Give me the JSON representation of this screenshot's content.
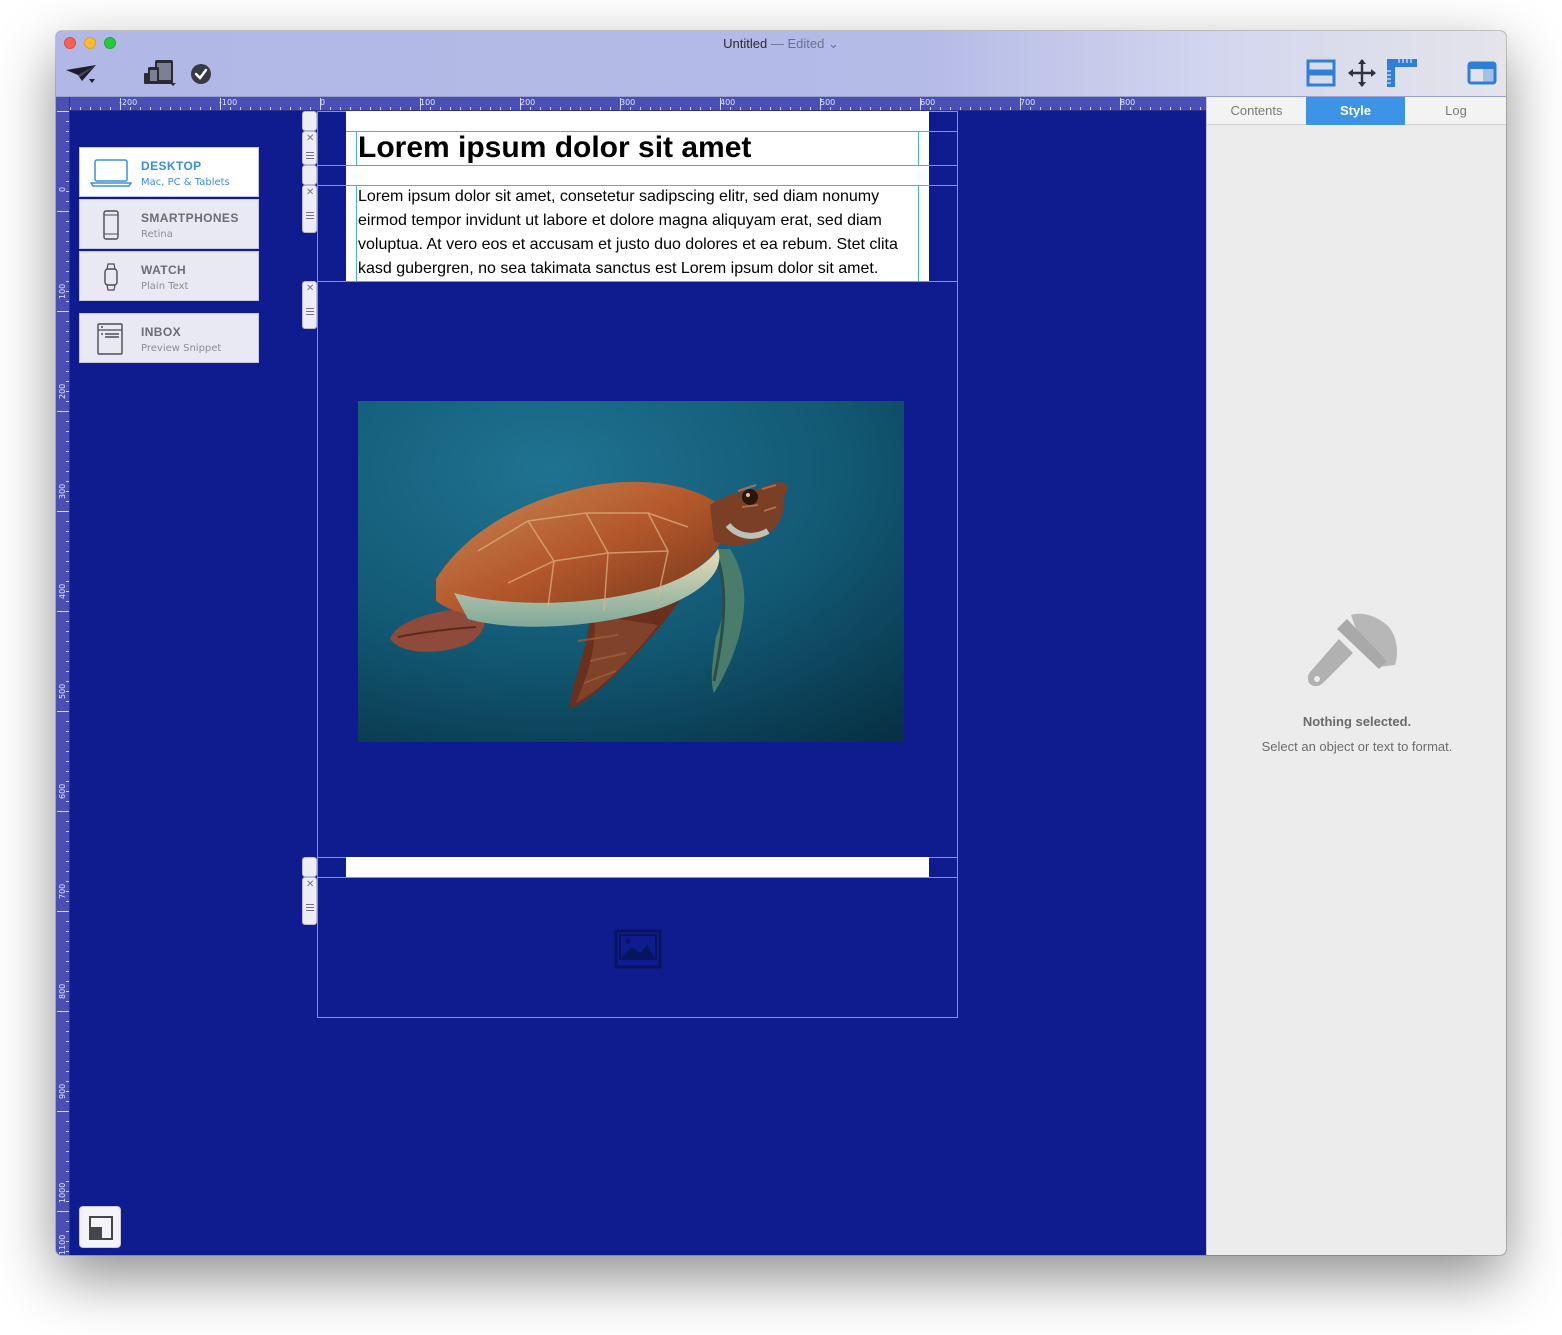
{
  "window": {
    "title": "Untitled",
    "status": "— Edited",
    "chevron": "⌄"
  },
  "toolbar": {
    "left_icons": [
      "paper-plane-icon",
      "devices-icon",
      "checkmark-icon"
    ],
    "right_icons": [
      "layout-rows-icon",
      "move-arrows-icon",
      "ruler-icon",
      "sidebar-toggle-icon"
    ],
    "accent": "#3b8de0"
  },
  "ruler": {
    "horizontal": [
      "-200",
      "-100",
      "0",
      "100",
      "200",
      "300",
      "400",
      "500",
      "600",
      "700",
      "800"
    ],
    "vertical": [
      "0",
      "100",
      "200",
      "300",
      "400",
      "500",
      "600",
      "700",
      "800",
      "900",
      "1000",
      "1100"
    ]
  },
  "devices": [
    {
      "title": "DESKTOP",
      "subtitle": "Mac, PC & Tablets",
      "icon": "laptop-icon",
      "active": true
    },
    {
      "title": "SMARTPHONES",
      "subtitle": "Retina",
      "icon": "smartphone-icon",
      "active": false
    },
    {
      "title": "WATCH",
      "subtitle": "Plain Text",
      "icon": "watch-icon",
      "active": false
    },
    {
      "title": "INBOX",
      "subtitle": "Preview Snippet",
      "icon": "inbox-icon",
      "active": false
    }
  ],
  "document": {
    "headline": "Lorem ipsum dolor sit amet",
    "body": "Lorem ipsum dolor sit amet, consetetur sadipscing elitr, sed diam nonumy eirmod tempor invidunt ut labore et dolore magna aliquyam erat, sed diam voluptua. At vero eos et accusam et justo duo dolores et ea rebum. Stet clita kasd gubergren, no sea takimata sanctus est Lorem ipsum dolor sit amet.",
    "image_subject": "sea-turtle-photo",
    "background": "#0f1c8f"
  },
  "sidebar": {
    "tabs": [
      {
        "label": "Contents",
        "active": false
      },
      {
        "label": "Style",
        "active": true
      },
      {
        "label": "Log",
        "active": false
      }
    ],
    "empty_icon": "paintbrush-icon",
    "empty_title": "Nothing selected.",
    "empty_subtitle": "Select an object or text to format."
  }
}
